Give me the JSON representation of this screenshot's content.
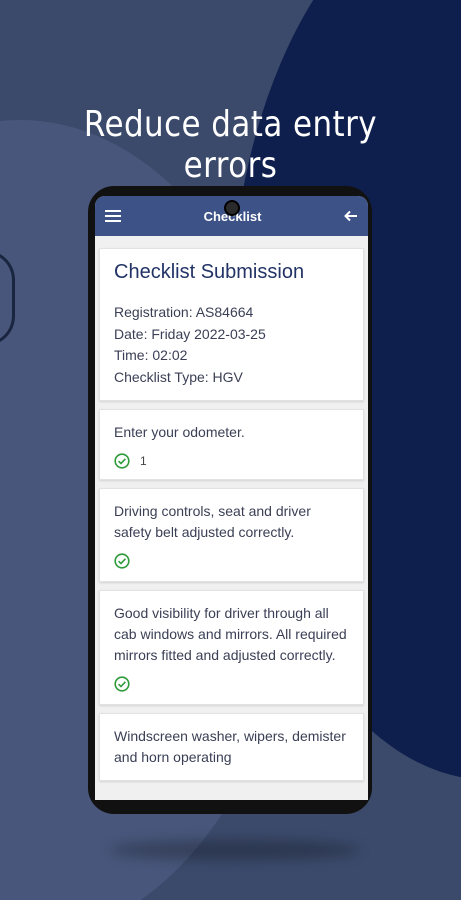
{
  "headline": "Reduce data entry errors",
  "appbar": {
    "title": "Checklist",
    "menu_icon": "menu-icon",
    "back_icon": "back-arrow-icon"
  },
  "submission": {
    "title": "Checklist Submission",
    "registration": "Registration: AS84664",
    "date": "Date: Friday 2022-03-25",
    "time": "Time: 02:02",
    "type": "Checklist Type: HGV"
  },
  "items": [
    {
      "text": "Enter your odometer.",
      "answer": "1"
    },
    {
      "text": "Driving controls, seat and driver safety belt adjusted correctly."
    },
    {
      "text": "Good visibility for driver through all cab windows and mirrors. All required mirrors fitted and adjusted correctly."
    },
    {
      "text": "Windscreen washer, wipers, demister and horn operating"
    }
  ],
  "colors": {
    "appbar": "#3d5388",
    "check": "#2e9a3a",
    "bg_dark": "#0f1f4d"
  }
}
